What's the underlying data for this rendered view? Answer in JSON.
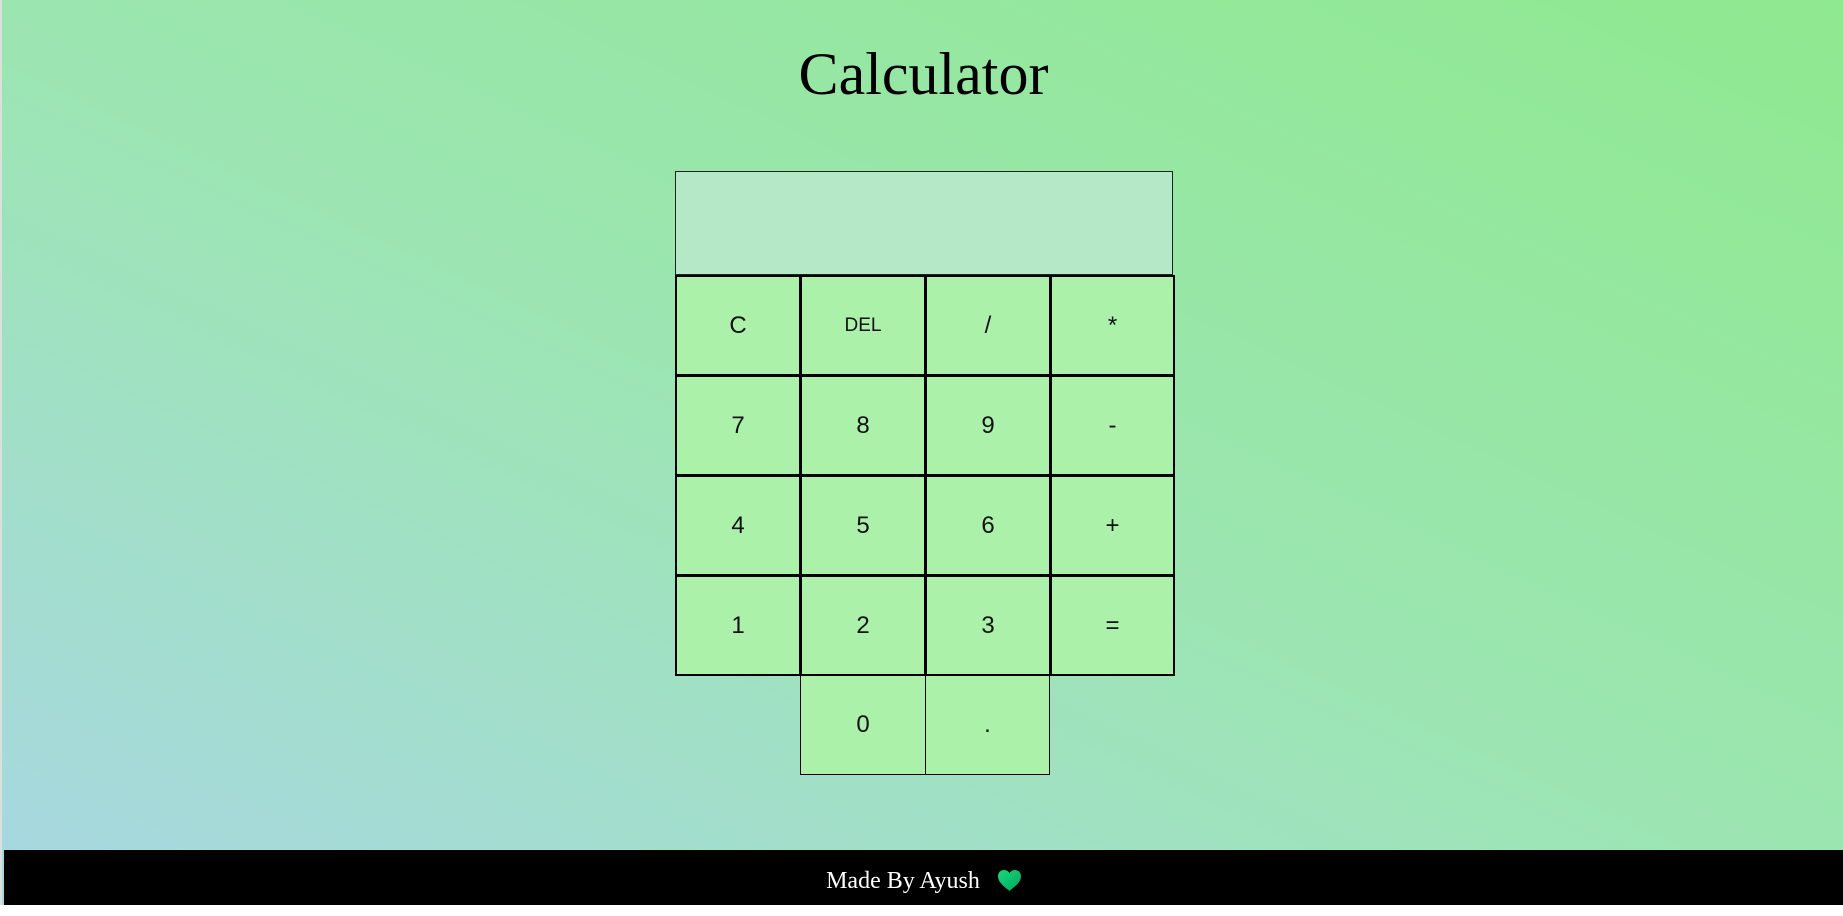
{
  "title": "Calculator",
  "display": {
    "value": ""
  },
  "keys": [
    "C",
    "DEL",
    "/",
    "*",
    "7",
    "8",
    "9",
    "-",
    "4",
    "5",
    "6",
    "+",
    "1",
    "2",
    "3",
    "=",
    "0",
    "."
  ],
  "footer": {
    "text": "Made By Ayush",
    "icon": "heart-icon",
    "icon_color": "#00c46a"
  },
  "colors": {
    "background_top_right": "#8fe98f",
    "background_bottom_left": "#a8d7e3",
    "display": "#b4e8c7",
    "button": "#abf1aa",
    "footer": "#000000"
  }
}
